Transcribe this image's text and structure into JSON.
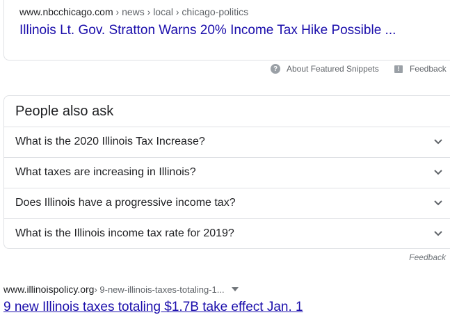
{
  "featured_snippet": {
    "domain": "www.nbcchicago.com",
    "breadcrumb": " › news › local › chicago-politics",
    "title": "Illinois Lt. Gov. Stratton Warns 20% Income Tax Hike Possible ...",
    "about_label": "About Featured Snippets",
    "feedback_label": "Feedback"
  },
  "people_also_ask": {
    "heading": "People also ask",
    "questions": [
      "What is the 2020 Illinois Tax Increase?",
      "What taxes are increasing in Illinois?",
      "Does Illinois have a progressive income tax?",
      "What is the Illinois income tax rate for 2019?"
    ],
    "feedback_label": "Feedback"
  },
  "result": {
    "domain": "www.illinoispolicy.org",
    "breadcrumb": " › 9-new-illinois-taxes-totaling-1...",
    "title": "9 new Illinois taxes totaling $1.7B take effect Jan. 1"
  },
  "icons": {
    "help": "question-circle-icon",
    "feedback": "flag-icon",
    "expand": "chevron-down-icon",
    "menu": "caret-down-icon"
  },
  "colors": {
    "link": "#1a0dab",
    "text": "#202124",
    "muted": "#5f6368",
    "border": "#dfe1e5"
  }
}
